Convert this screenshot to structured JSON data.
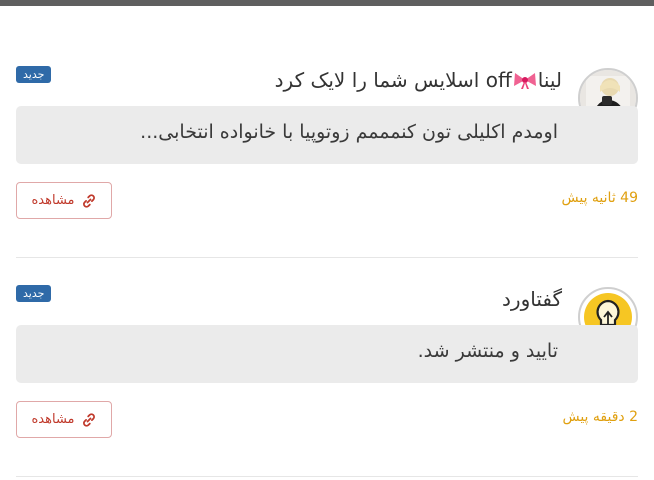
{
  "notifications": [
    {
      "badge": "جدید",
      "title_before": "لینا",
      "title_after": "off اسلایس شما را لایک کرد",
      "message": "اومدم اکلیلی تون کنمممم زوتوپیا با خانواده انتخابی...",
      "view_label": "مشاهده",
      "time": "49 ثانیه پیش",
      "avatar": "user-photo",
      "title_emoji": "ribbon-bow"
    },
    {
      "badge": "جدید",
      "title_before": "گفتاورد",
      "title_after": "",
      "message": "تایید و منتشر شد.",
      "view_label": "مشاهده",
      "time": "2 دقیقه پیش",
      "avatar": "lightbulb-icon"
    }
  ],
  "colors": {
    "badge_bg": "#2f6aa8",
    "message_bg": "#ebebeb",
    "view_button": "#c0392b",
    "time_text": "#e0a010"
  }
}
